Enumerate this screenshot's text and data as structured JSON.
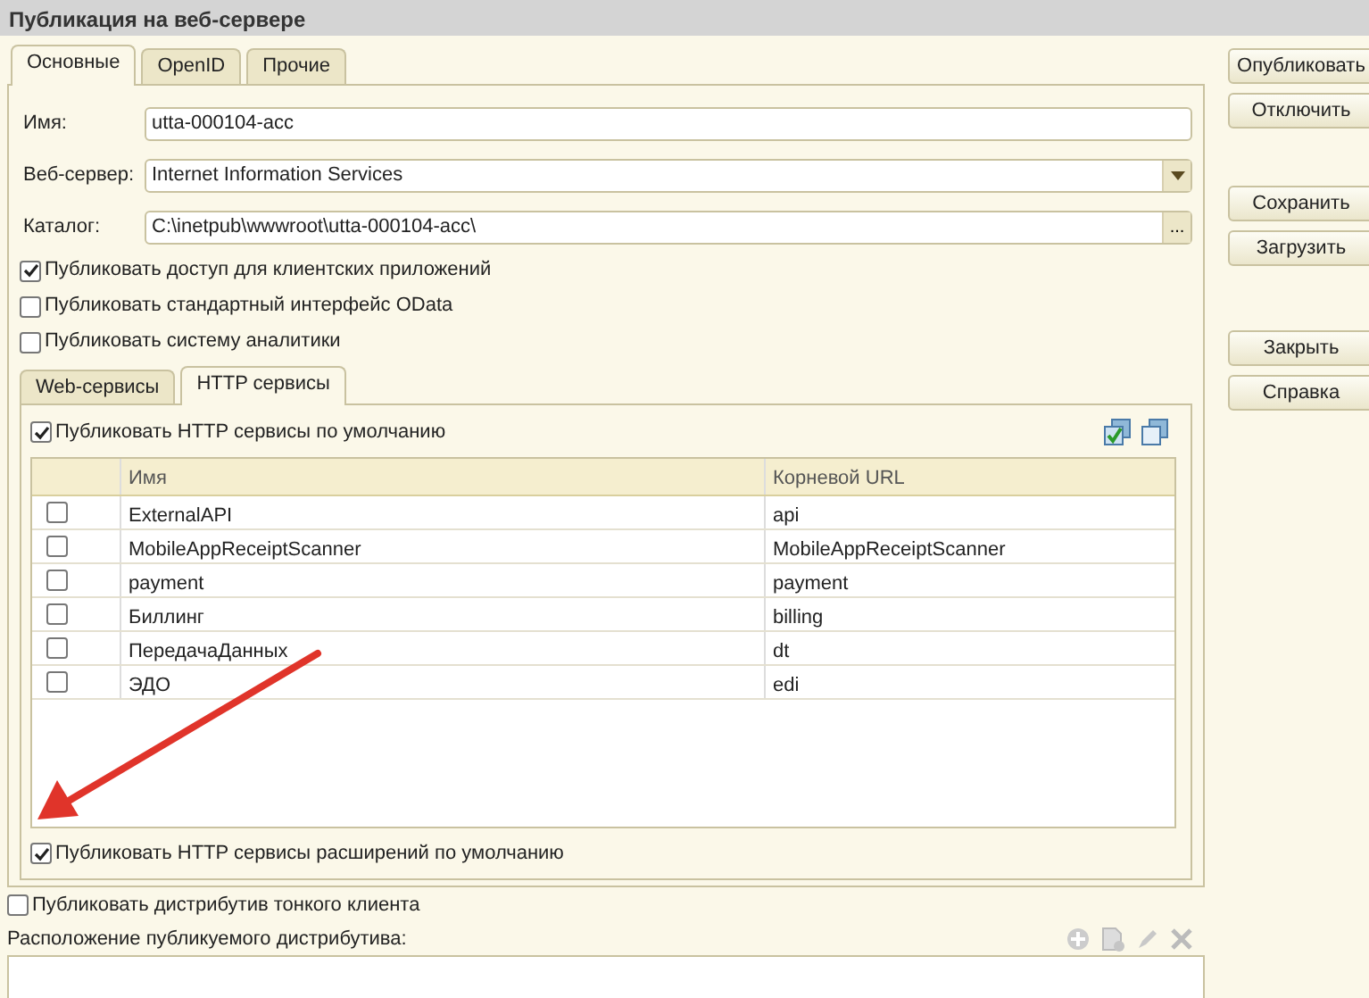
{
  "window": {
    "title": "Публикация на веб-сервере"
  },
  "tabs": [
    {
      "label": "Основные",
      "selected": true
    },
    {
      "label": "OpenID",
      "selected": false
    },
    {
      "label": "Прочие",
      "selected": false
    }
  ],
  "fields": [
    {
      "kind": "text",
      "label": "Имя:",
      "value": "utta-000104-acc"
    },
    {
      "kind": "dropdown",
      "label": "Веб-сервер:",
      "value": "Internet Information Services"
    },
    {
      "kind": "browse",
      "label": "Каталог:",
      "value": "C:\\inetpub\\wwwroot\\utta-000104-acc\\",
      "button": "..."
    }
  ],
  "options": [
    {
      "label": "Публиковать доступ для клиентских приложений",
      "checked": true
    },
    {
      "label": "Публиковать стандартный интерфейс OData",
      "checked": false
    },
    {
      "label": "Публиковать систему аналитики",
      "checked": false
    }
  ],
  "inner_tabs": [
    {
      "label": "Web-сервисы",
      "selected": false
    },
    {
      "label": "HTTP сервисы",
      "selected": true
    }
  ],
  "http_services": {
    "publish_default": {
      "label": "Публиковать HTTP сервисы по умолчанию",
      "checked": true
    },
    "columns": [
      "Имя",
      "Корневой URL"
    ],
    "rows": [
      {
        "checked": false,
        "name": "ExternalAPI",
        "url": "api"
      },
      {
        "checked": false,
        "name": "MobileAppReceiptScanner",
        "url": "MobileAppReceiptScanner"
      },
      {
        "checked": false,
        "name": "payment",
        "url": "payment"
      },
      {
        "checked": false,
        "name": "Биллинг",
        "url": "billing"
      },
      {
        "checked": false,
        "name": "ПередачаДанных",
        "url": "dt"
      },
      {
        "checked": false,
        "name": "ЭДО",
        "url": "edi"
      }
    ],
    "publish_extensions": {
      "label": "Публиковать HTTP сервисы расширений по умолчанию",
      "checked": true
    }
  },
  "thin_client": {
    "label": "Публиковать дистрибутив тонкого клиента",
    "checked": false
  },
  "distribution": {
    "label": "Расположение публикуемого дистрибутива:"
  },
  "button_groups": [
    [
      "Опубликовать",
      "Отключить"
    ],
    [
      "Сохранить",
      "Загрузить"
    ],
    [
      "Закрыть",
      "Справка"
    ]
  ]
}
